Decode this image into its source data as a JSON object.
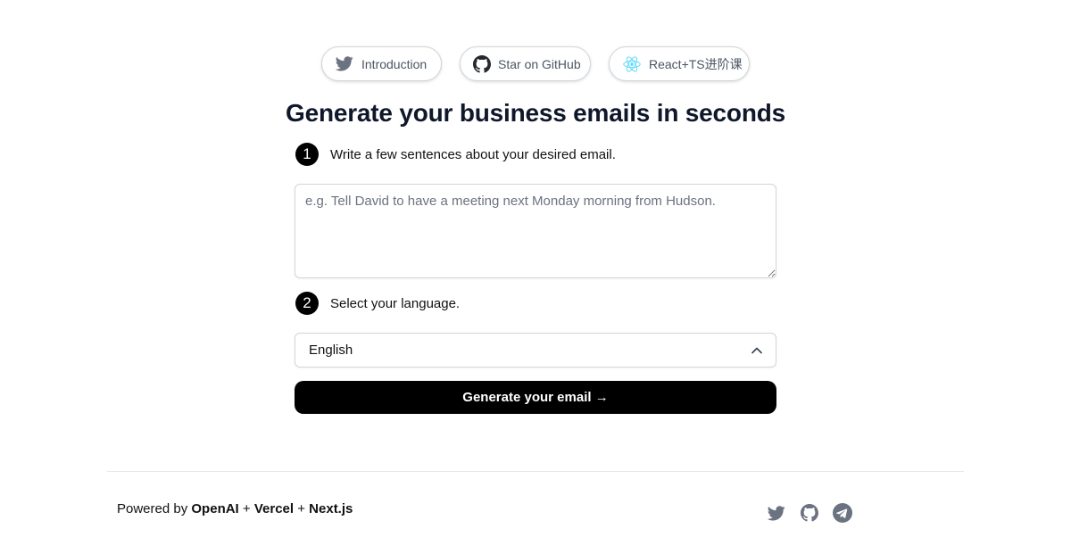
{
  "top_links": {
    "introduction": {
      "label": "Introduction",
      "icon": "twitter-icon"
    },
    "github": {
      "label": "Star on GitHub",
      "icon": "github-icon"
    },
    "course": {
      "label": "React+TS进阶课",
      "icon": "react-icon"
    }
  },
  "heading": "Generate your business emails in seconds",
  "steps": [
    {
      "number": "1",
      "text": "Write a few sentences about your desired email."
    },
    {
      "number": "2",
      "text": "Select your language."
    }
  ],
  "email_input": {
    "value": "",
    "placeholder": "e.g. Tell David to have a meeting next Monday morning from Hudson."
  },
  "language_select": {
    "selected": "English",
    "icon": "chevron-up-icon"
  },
  "generate_button": {
    "label": "Generate your email →"
  },
  "footer": {
    "powered_prefix": "Powered by ",
    "openai": "OpenAI",
    "plus1": " + ",
    "vercel": "Vercel",
    "plus2": " + ",
    "nextjs": "Next.js",
    "socials": [
      "twitter-icon",
      "github-icon",
      "telegram-icon"
    ]
  },
  "colors": {
    "twitter_blue": "#1d9bf0",
    "react_cyan": "#61dafb",
    "social_gray": "#6b7280",
    "button_black": "#000000"
  }
}
